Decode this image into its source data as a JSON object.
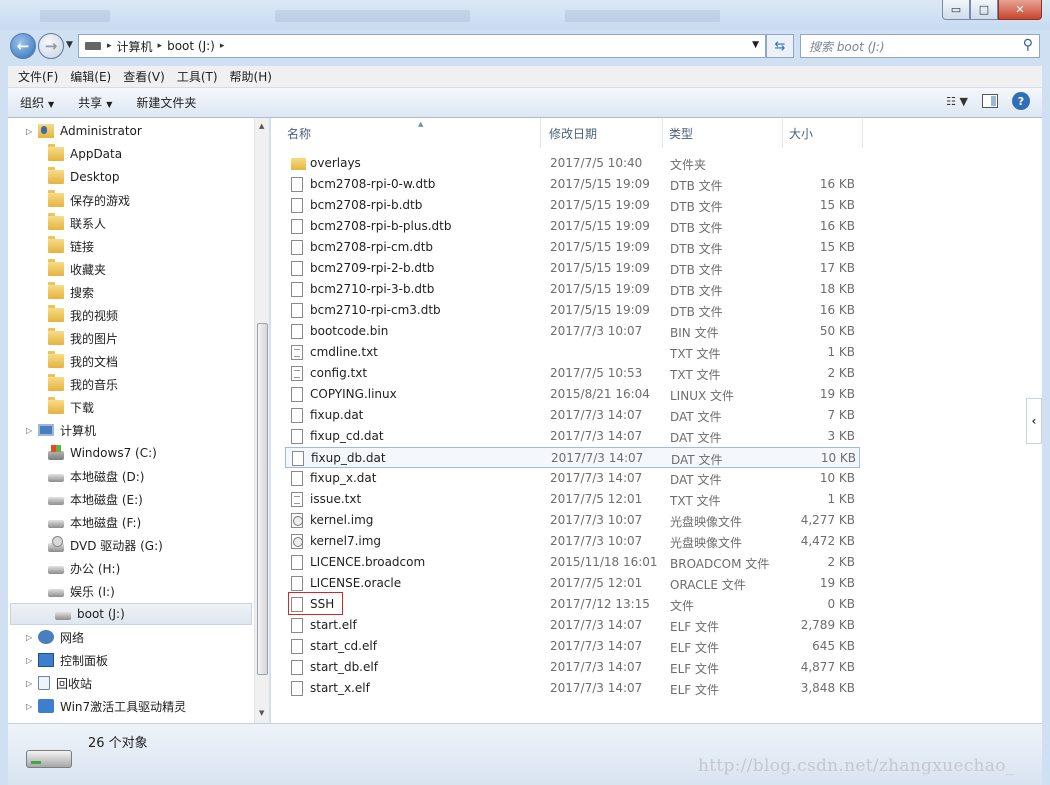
{
  "window": {
    "minimize": "▭",
    "maximize": "□",
    "close": "✕"
  },
  "nav": {
    "back": "←",
    "forward": "→"
  },
  "address": {
    "crumbs": [
      "计算机",
      "boot (J:)"
    ]
  },
  "search": {
    "placeholder": "搜索 boot (J:)"
  },
  "menu": [
    "文件(F)",
    "编辑(E)",
    "查看(V)",
    "工具(T)",
    "帮助(H)"
  ],
  "toolbar": {
    "organize": "组织",
    "share": "共享",
    "new_folder": "新建文件夹",
    "help": "?"
  },
  "sidebar": [
    {
      "label": "Administrator",
      "icon": "user-folder-icon",
      "level": 1
    },
    {
      "label": "AppData",
      "icon": "folder-icon",
      "level": 2
    },
    {
      "label": "Desktop",
      "icon": "folder-icon",
      "level": 2
    },
    {
      "label": "保存的游戏",
      "icon": "folder-icon",
      "level": 2
    },
    {
      "label": "联系人",
      "icon": "folder-icon",
      "level": 2
    },
    {
      "label": "链接",
      "icon": "folder-icon",
      "level": 2
    },
    {
      "label": "收藏夹",
      "icon": "folder-icon",
      "level": 2
    },
    {
      "label": "搜索",
      "icon": "folder-icon",
      "level": 2
    },
    {
      "label": "我的视频",
      "icon": "folder-icon",
      "level": 2
    },
    {
      "label": "我的图片",
      "icon": "folder-icon",
      "level": 2
    },
    {
      "label": "我的文档",
      "icon": "folder-icon",
      "level": 2
    },
    {
      "label": "我的音乐",
      "icon": "folder-icon",
      "level": 2
    },
    {
      "label": "下载",
      "icon": "folder-icon",
      "level": 2
    },
    {
      "label": "计算机",
      "icon": "computer-icon",
      "level": 1
    },
    {
      "label": "Windows7 (C:)",
      "icon": "system-drive-icon",
      "level": 2
    },
    {
      "label": "本地磁盘 (D:)",
      "icon": "drive-icon",
      "level": 2
    },
    {
      "label": "本地磁盘 (E:)",
      "icon": "drive-icon",
      "level": 2
    },
    {
      "label": "本地磁盘 (F:)",
      "icon": "drive-icon",
      "level": 2
    },
    {
      "label": "DVD 驱动器 (G:)",
      "icon": "dvd-drive-icon",
      "level": 2
    },
    {
      "label": "办公 (H:)",
      "icon": "drive-icon",
      "level": 2
    },
    {
      "label": "娱乐 (I:)",
      "icon": "drive-icon",
      "level": 2
    },
    {
      "label": "boot (J:)",
      "icon": "removable-drive-icon",
      "level": 2,
      "selected": true
    },
    {
      "label": "网络",
      "icon": "network-icon",
      "level": 1
    },
    {
      "label": "控制面板",
      "icon": "control-panel-icon",
      "level": 1
    },
    {
      "label": "回收站",
      "icon": "recycle-bin-icon",
      "level": 1
    },
    {
      "label": "Win7激活工具驱动精灵",
      "icon": "app-icon",
      "level": 1
    }
  ],
  "columns": {
    "name": "名称",
    "date": "修改日期",
    "type": "类型",
    "size": "大小"
  },
  "files": [
    {
      "name": "overlays",
      "date": "2017/7/5 10:40",
      "type": "文件夹",
      "size": "",
      "icon": "folder-icon"
    },
    {
      "name": "bcm2708-rpi-0-w.dtb",
      "date": "2017/5/15 19:09",
      "type": "DTB 文件",
      "size": "16 KB",
      "icon": "file-icon"
    },
    {
      "name": "bcm2708-rpi-b.dtb",
      "date": "2017/5/15 19:09",
      "type": "DTB 文件",
      "size": "15 KB",
      "icon": "file-icon"
    },
    {
      "name": "bcm2708-rpi-b-plus.dtb",
      "date": "2017/5/15 19:09",
      "type": "DTB 文件",
      "size": "16 KB",
      "icon": "file-icon"
    },
    {
      "name": "bcm2708-rpi-cm.dtb",
      "date": "2017/5/15 19:09",
      "type": "DTB 文件",
      "size": "15 KB",
      "icon": "file-icon"
    },
    {
      "name": "bcm2709-rpi-2-b.dtb",
      "date": "2017/5/15 19:09",
      "type": "DTB 文件",
      "size": "17 KB",
      "icon": "file-icon"
    },
    {
      "name": "bcm2710-rpi-3-b.dtb",
      "date": "2017/5/15 19:09",
      "type": "DTB 文件",
      "size": "18 KB",
      "icon": "file-icon"
    },
    {
      "name": "bcm2710-rpi-cm3.dtb",
      "date": "2017/5/15 19:09",
      "type": "DTB 文件",
      "size": "16 KB",
      "icon": "file-icon"
    },
    {
      "name": "bootcode.bin",
      "date": "2017/7/3 10:07",
      "type": "BIN 文件",
      "size": "50 KB",
      "icon": "file-icon"
    },
    {
      "name": "cmdline.txt",
      "date": "",
      "type": "TXT 文件",
      "size": "1 KB",
      "icon": "text-file-icon"
    },
    {
      "name": "config.txt",
      "date": "2017/7/5 10:53",
      "type": "TXT 文件",
      "size": "2 KB",
      "icon": "text-file-icon"
    },
    {
      "name": "COPYING.linux",
      "date": "2015/8/21 16:04",
      "type": "LINUX 文件",
      "size": "19 KB",
      "icon": "file-icon"
    },
    {
      "name": "fixup.dat",
      "date": "2017/7/3 14:07",
      "type": "DAT 文件",
      "size": "7 KB",
      "icon": "file-icon"
    },
    {
      "name": "fixup_cd.dat",
      "date": "2017/7/3 14:07",
      "type": "DAT 文件",
      "size": "3 KB",
      "icon": "file-icon"
    },
    {
      "name": "fixup_db.dat",
      "date": "2017/7/3 14:07",
      "type": "DAT 文件",
      "size": "10 KB",
      "icon": "file-icon",
      "focused": true
    },
    {
      "name": "fixup_x.dat",
      "date": "2017/7/3 14:07",
      "type": "DAT 文件",
      "size": "10 KB",
      "icon": "file-icon"
    },
    {
      "name": "issue.txt",
      "date": "2017/7/5 12:01",
      "type": "TXT 文件",
      "size": "1 KB",
      "icon": "text-file-icon"
    },
    {
      "name": "kernel.img",
      "date": "2017/7/3 10:07",
      "type": "光盘映像文件",
      "size": "4,277 KB",
      "icon": "disc-image-icon"
    },
    {
      "name": "kernel7.img",
      "date": "2017/7/3 10:07",
      "type": "光盘映像文件",
      "size": "4,472 KB",
      "icon": "disc-image-icon"
    },
    {
      "name": "LICENCE.broadcom",
      "date": "2015/11/18 16:01",
      "type": "BROADCOM 文件",
      "size": "2 KB",
      "icon": "file-icon"
    },
    {
      "name": "LICENSE.oracle",
      "date": "2017/7/5 12:01",
      "type": "ORACLE 文件",
      "size": "19 KB",
      "icon": "file-icon"
    },
    {
      "name": "SSH",
      "date": "2017/7/12 13:15",
      "type": "文件",
      "size": "0 KB",
      "icon": "file-icon",
      "highlighted": true
    },
    {
      "name": "start.elf",
      "date": "2017/7/3 14:07",
      "type": "ELF 文件",
      "size": "2,789 KB",
      "icon": "file-icon"
    },
    {
      "name": "start_cd.elf",
      "date": "2017/7/3 14:07",
      "type": "ELF 文件",
      "size": "645 KB",
      "icon": "file-icon"
    },
    {
      "name": "start_db.elf",
      "date": "2017/7/3 14:07",
      "type": "ELF 文件",
      "size": "4,877 KB",
      "icon": "file-icon"
    },
    {
      "name": "start_x.elf",
      "date": "2017/7/3 14:07",
      "type": "ELF 文件",
      "size": "3,848 KB",
      "icon": "file-icon"
    }
  ],
  "status": {
    "count": "26 个对象"
  },
  "watermark": "http://blog.csdn.net/zhangxuechao_",
  "colors": {
    "highlight_box": "#dd2222",
    "focus_border": "#9bbbe4",
    "window_frame": "#cfe0f3"
  }
}
